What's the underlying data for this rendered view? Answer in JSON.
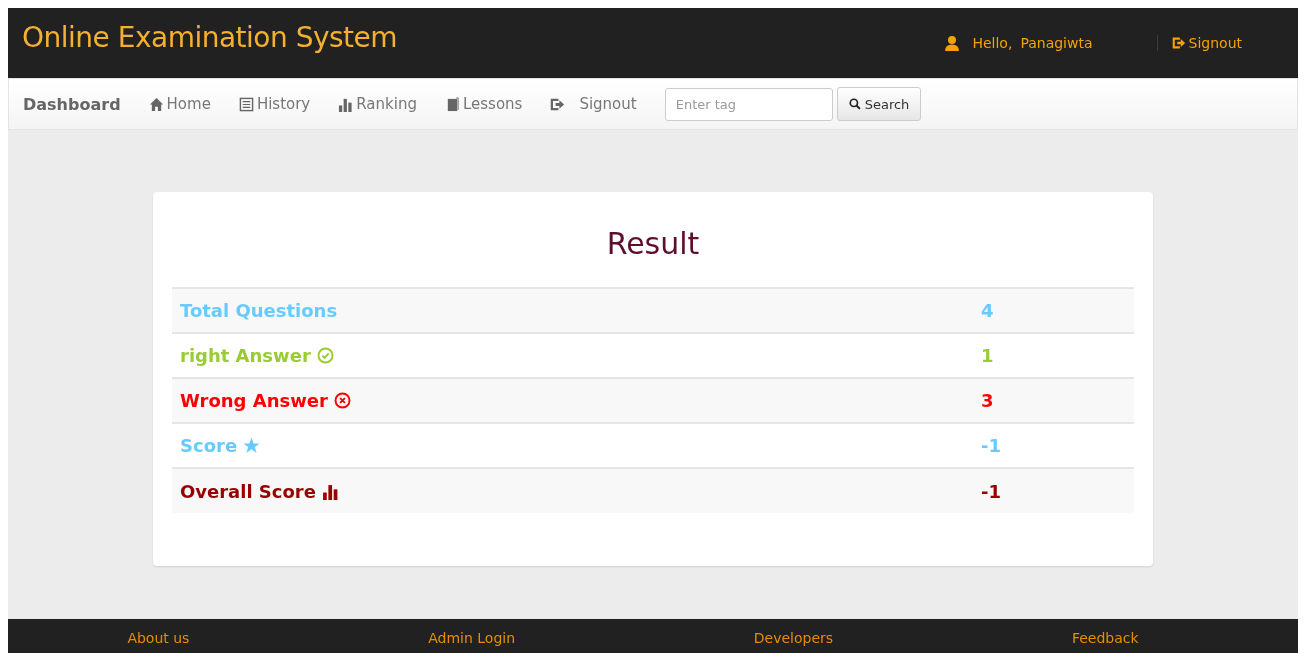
{
  "header": {
    "title": "Online Examination System",
    "greeting": "Hello,",
    "user": "Panagiwta",
    "signout": "Signout"
  },
  "navbar": {
    "brand": "Dashboard",
    "items": [
      {
        "label": "Home",
        "kind": "home"
      },
      {
        "label": "History",
        "kind": "list"
      },
      {
        "label": "Ranking",
        "kind": "bars"
      },
      {
        "label": "Lessons",
        "kind": "book"
      },
      {
        "label": "Signout",
        "kind": "signout"
      }
    ],
    "search": {
      "placeholder": "Enter tag",
      "button": "Search"
    }
  },
  "result": {
    "title": "Result",
    "rows": [
      {
        "label": "Total Questions",
        "value": "4",
        "color": "#66ccff",
        "kind": "plain"
      },
      {
        "label": "right Answer",
        "value": "1",
        "color": "#99cc33",
        "kind": "check"
      },
      {
        "label": "Wrong Answer",
        "value": "3",
        "color": "#ff0000",
        "kind": "cross"
      },
      {
        "label": "Score",
        "value": "-1",
        "color": "#66ccff",
        "kind": "star"
      },
      {
        "label": "Overall Score",
        "value": "-1",
        "color": "#990000",
        "kind": "bars"
      }
    ]
  },
  "footer": {
    "links": [
      "About us",
      "Admin Login",
      "Developers",
      "Feedback"
    ]
  }
}
